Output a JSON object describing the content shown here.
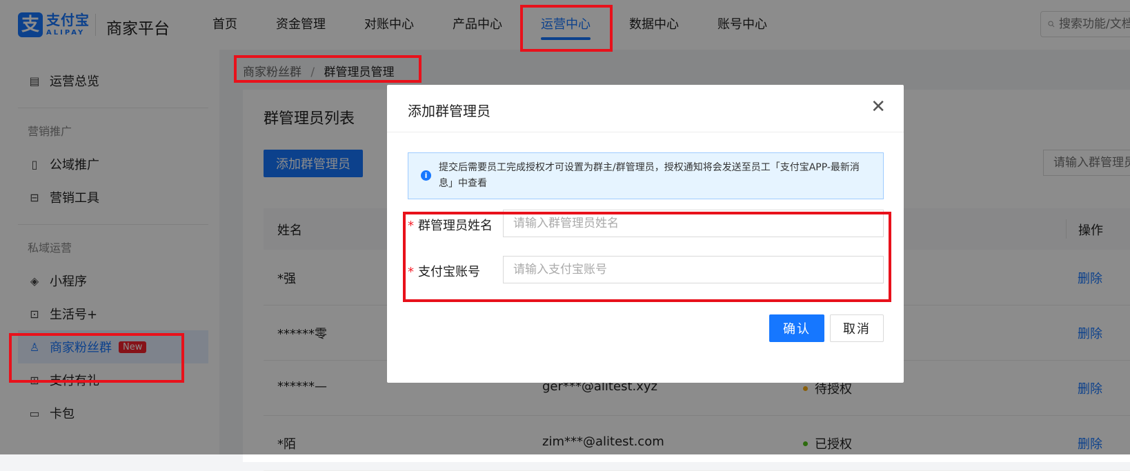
{
  "header": {
    "logo_cn": "支付宝",
    "logo_en": "ALIPAY",
    "platform": "商家平台",
    "nav": [
      {
        "label": "首页",
        "name": "nav-home"
      },
      {
        "label": "资金管理",
        "name": "nav-funds"
      },
      {
        "label": "对账中心",
        "name": "nav-reconcile"
      },
      {
        "label": "产品中心",
        "name": "nav-products"
      },
      {
        "label": "运营中心",
        "name": "nav-operations"
      },
      {
        "label": "数据中心",
        "name": "nav-data"
      },
      {
        "label": "账号中心",
        "name": "nav-account"
      }
    ],
    "active_nav": "运营中心",
    "search_placeholder": "搜索功能/文档"
  },
  "sidebar": {
    "overview": "运营总览",
    "group_marketing": "营销推广",
    "public_promo": "公域推广",
    "marketing_tools": "营销工具",
    "group_private": "私域运营",
    "mini_program": "小程序",
    "life_account": "生活号+",
    "fans_group": "商家粉丝群",
    "fans_badge": "New",
    "pay_gift": "支付有礼",
    "card_wallet": "卡包"
  },
  "breadcrumb": {
    "parent": "商家粉丝群",
    "separator": "/",
    "current": "群管理员管理"
  },
  "main": {
    "title": "群管理员列表",
    "add_button": "添加群管理员",
    "filter_placeholder": "请输入群管理员姓名",
    "col_name": "姓名",
    "col_op": "操作",
    "rows": [
      {
        "name": "*强",
        "account": "",
        "status": "",
        "action": "删除"
      },
      {
        "name": "******零",
        "account": "",
        "status": "",
        "action": "删除"
      },
      {
        "name": "******—",
        "account": "ger***@alitest.xyz",
        "status": "待授权",
        "action": "删除"
      },
      {
        "name": "*陌",
        "account": "zim***@alitest.com",
        "status": "已授权",
        "action": "删除"
      }
    ]
  },
  "modal": {
    "title": "添加群管理员",
    "notice": "提交后需要员工完成授权才可设置为群主/群管理员，授权通知将会发送至员工「支付宝APP-最新消息」中查看",
    "field_name_label": "群管理员姓名",
    "field_name_placeholder": "请输入群管理员姓名",
    "field_account_label": "支付宝账号",
    "field_account_placeholder": "请输入支付宝账号",
    "required_mark": "*",
    "confirm": "确认",
    "cancel": "取消"
  },
  "colors": {
    "brand": "#1677ff",
    "highlight": "#e8111b",
    "status_pending": "#faad14",
    "status_ok": "#52c41a"
  }
}
